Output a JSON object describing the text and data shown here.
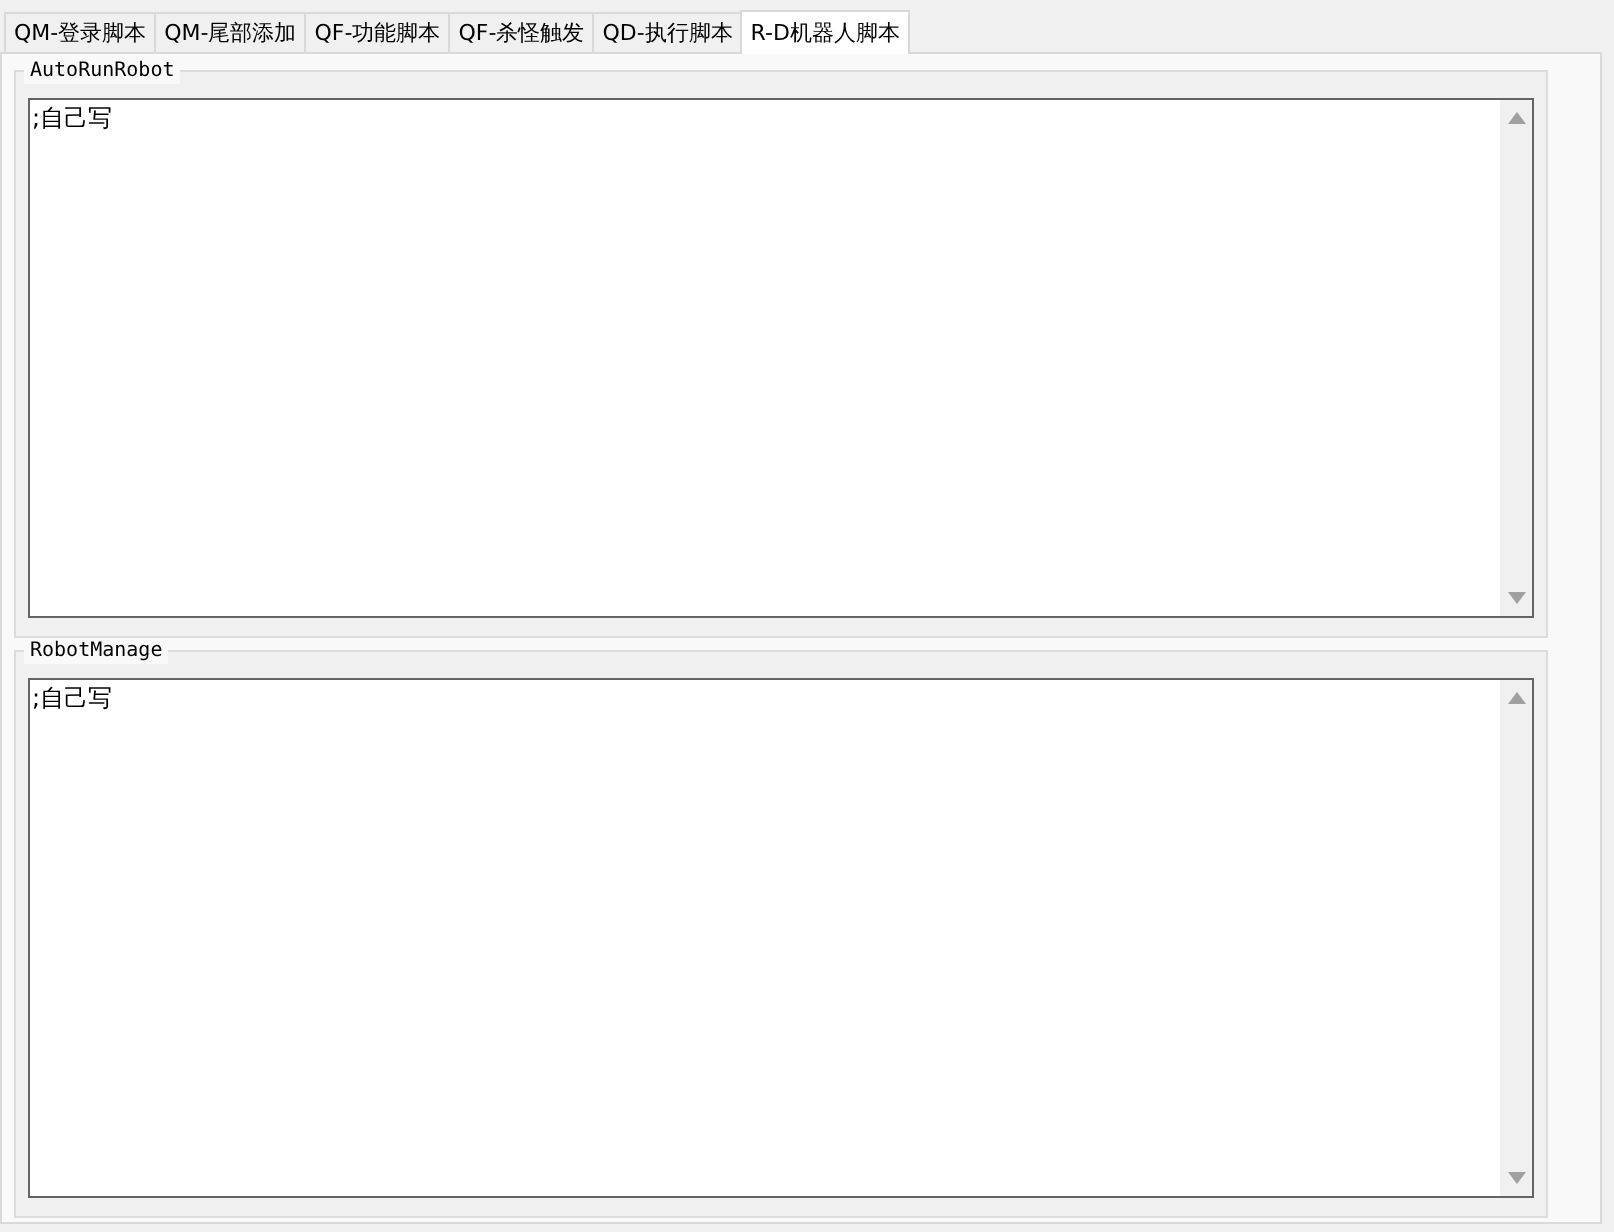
{
  "tabs": [
    {
      "label": "QM-登录脚本",
      "selected": false
    },
    {
      "label": "QM-尾部添加",
      "selected": false
    },
    {
      "label": "QF-功能脚本",
      "selected": false
    },
    {
      "label": "QF-杀怪触发",
      "selected": false
    },
    {
      "label": "QD-执行脚本",
      "selected": false
    },
    {
      "label": "R-D机器人脚本",
      "selected": true
    }
  ],
  "groups": [
    {
      "title": "AutoRunRobot",
      "text": ";自己写"
    },
    {
      "title": "RobotManage",
      "text": ";自己写"
    }
  ]
}
